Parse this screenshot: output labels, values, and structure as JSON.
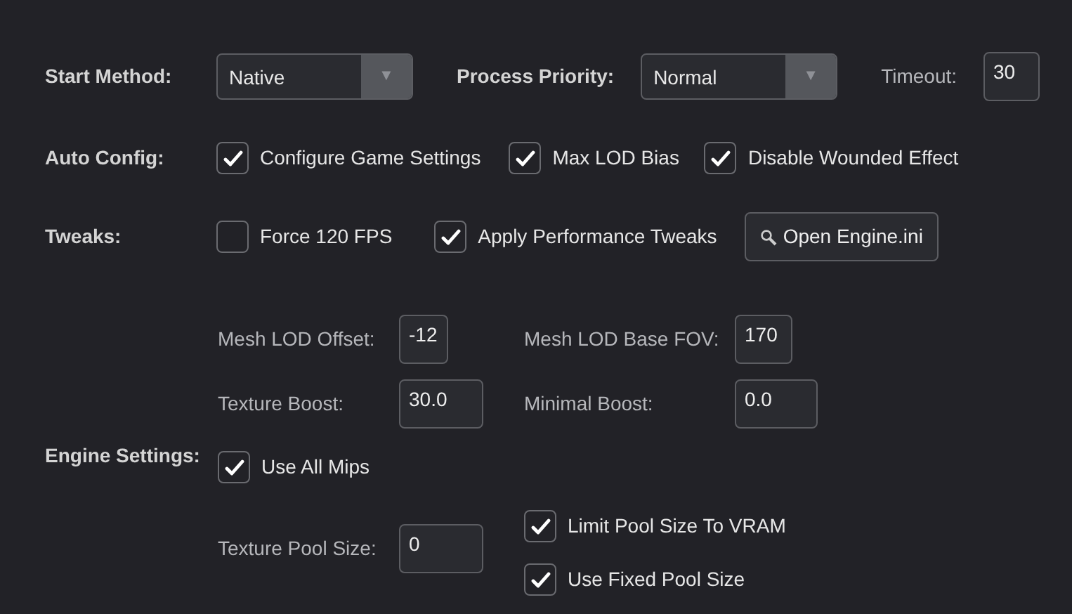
{
  "start_method": {
    "label": "Start Method:",
    "value": "Native",
    "arrow": "▼"
  },
  "process_priority": {
    "label": "Process Priority:",
    "value": "Normal",
    "arrow": "▼"
  },
  "timeout": {
    "label": "Timeout:",
    "value": "30"
  },
  "auto_config": {
    "label": "Auto Config:",
    "options": [
      {
        "label": "Configure Game Settings",
        "checked": true
      },
      {
        "label": "Max LOD Bias",
        "checked": true
      },
      {
        "label": "Disable Wounded Effect",
        "checked": true
      }
    ]
  },
  "tweaks": {
    "label": "Tweaks:",
    "options": [
      {
        "label": "Force 120 FPS",
        "checked": false
      },
      {
        "label": "Apply Performance Tweaks",
        "checked": true
      }
    ],
    "button": "Open Engine.ini"
  },
  "engine_settings": {
    "label": "Engine Settings:",
    "rows": [
      {
        "items": [
          {
            "kind": "field",
            "label": "Mesh LOD Offset:",
            "value": "-12"
          },
          {
            "kind": "field",
            "label": "Mesh LOD Base FOV:",
            "value": "170"
          }
        ]
      },
      {
        "items": [
          {
            "kind": "field",
            "label": "Texture Boost:",
            "value": "30.0"
          },
          {
            "kind": "field",
            "label": "Minimal Boost:",
            "value": "0.0"
          }
        ]
      },
      {
        "items": [
          {
            "kind": "checkbox",
            "label": "Use All Mips",
            "checked": true
          }
        ]
      },
      {
        "items": [
          {
            "kind": "field",
            "label": "Texture Pool Size:",
            "value": "0"
          },
          {
            "kind": "stack",
            "children": [
              {
                "kind": "checkbox",
                "label": "Limit Pool Size To VRAM",
                "checked": true
              },
              {
                "kind": "checkbox",
                "label": "Use Fixed Pool Size",
                "checked": true
              }
            ]
          }
        ]
      }
    ]
  }
}
